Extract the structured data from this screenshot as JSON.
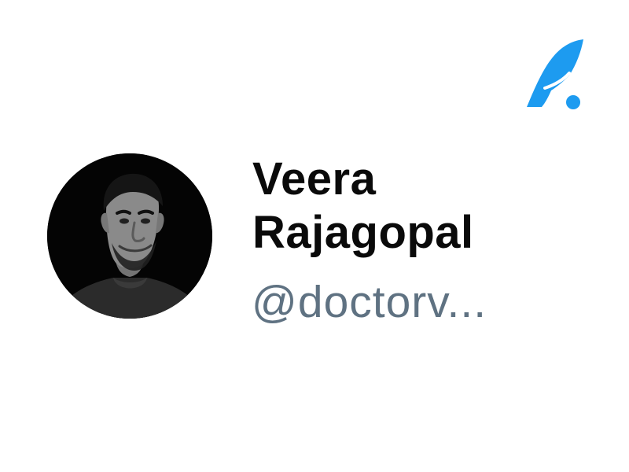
{
  "brand": {
    "icon": "quill-feather-icon",
    "color": "#1d9bf0"
  },
  "profile": {
    "avatar_icon": "person-photo-avatar",
    "name_line1": "Veera",
    "name_line2": "Rajagopal",
    "handle": "@doctorv..."
  },
  "colors": {
    "background": "#ffffff",
    "name": "#0a0a0a",
    "handle": "#5f7282"
  }
}
